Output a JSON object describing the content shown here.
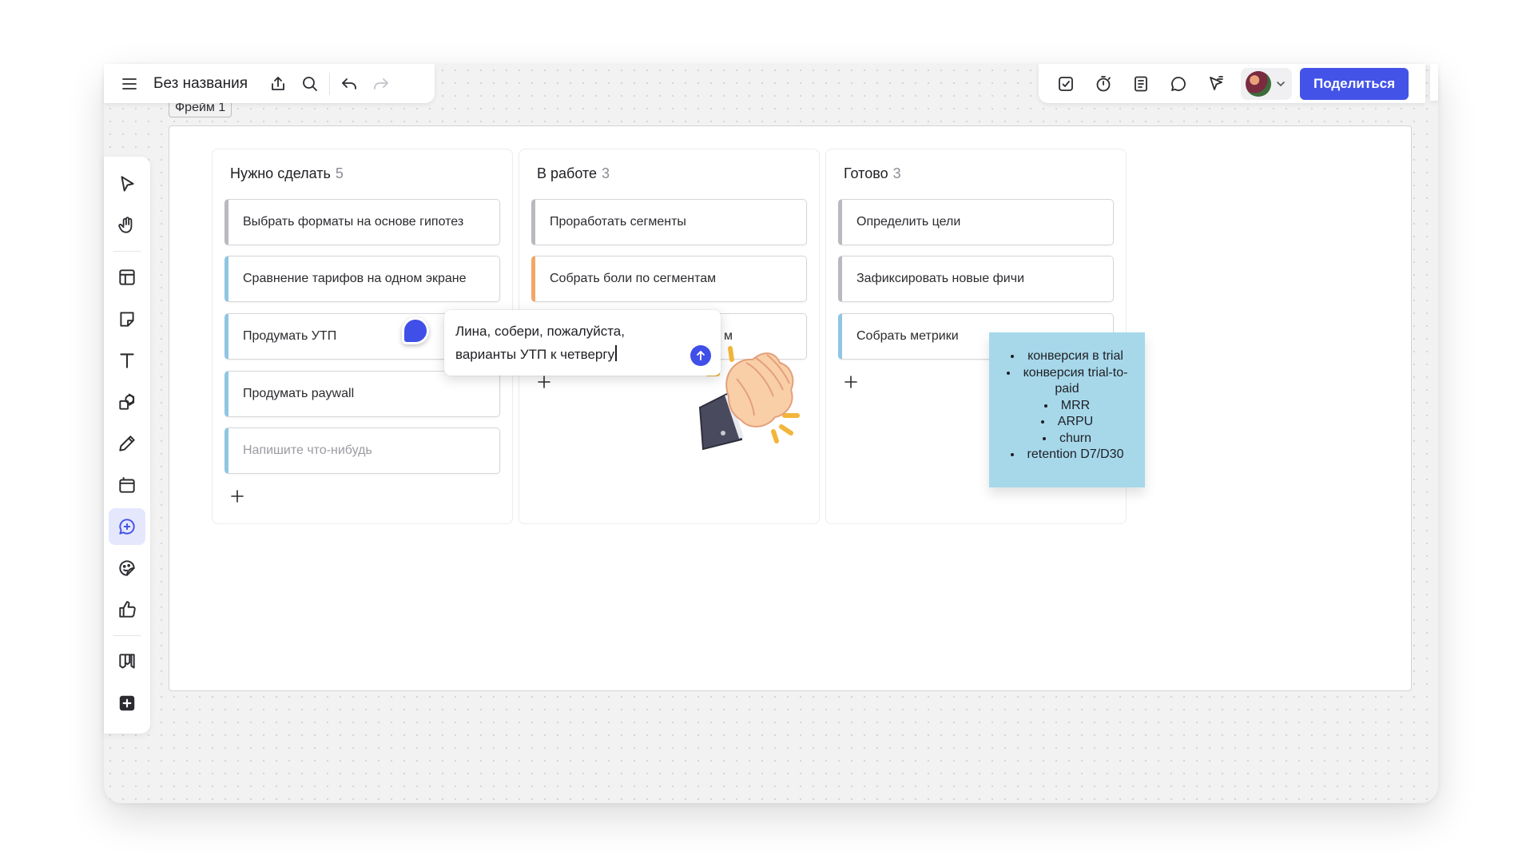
{
  "board": {
    "title": "Без названия",
    "frame_label": "Фрейм 1",
    "share_label": "Поделиться"
  },
  "columns": [
    {
      "title": "Нужно сделать",
      "count": "5",
      "cards": [
        {
          "text": "Выбрать форматы на основе гипотез",
          "color": "#b9b9bf"
        },
        {
          "text": "Сравнение тарифов на одном экране",
          "color": "#8fc6e3"
        },
        {
          "text": "Продумать УТП",
          "color": "#8fc6e3"
        },
        {
          "text": "Продумать paywall",
          "color": "#8fc6e3"
        },
        {
          "text": "Напишите что-нибудь",
          "color": "#8fc6e3",
          "placeholder": true
        }
      ]
    },
    {
      "title": "В работе",
      "count": "3",
      "cards": [
        {
          "text": "Проработать сегменты",
          "color": "#b9b9bf"
        },
        {
          "text": "Собрать боли по сегментам",
          "color": "#f2a766"
        },
        {
          "text": "м",
          "color": "#b9b9bf"
        }
      ]
    },
    {
      "title": "Готово",
      "count": "3",
      "cards": [
        {
          "text": "Определить цели",
          "color": "#b9b9bf"
        },
        {
          "text": "Зафиксировать новые фичи",
          "color": "#b9b9bf"
        },
        {
          "text": "Собрать метрики",
          "color": "#8fc6e3"
        }
      ]
    }
  ],
  "comment": {
    "line1": "Лина, собери, пожалуйста,",
    "line2": "варианты УТП к четвергу"
  },
  "sticky_note": {
    "color": "#a6d8ea",
    "items": [
      "конверсия в trial",
      "конверсия trial-to-paid",
      "MRR",
      "ARPU",
      "churn",
      "retention D7/D30"
    ]
  },
  "colors": {
    "accent": "#4353e8",
    "comment_pin": "#3f4fe8"
  }
}
